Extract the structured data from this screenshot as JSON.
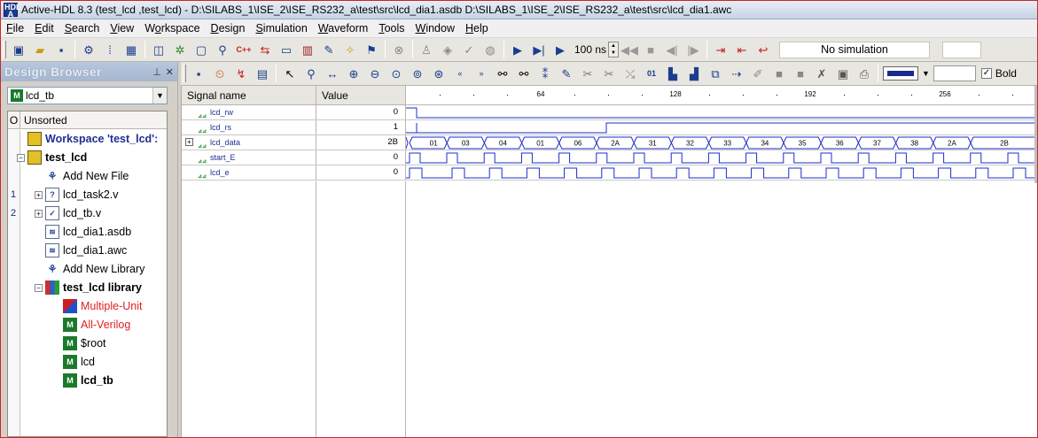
{
  "title": "Active-HDL 8.3 (test_lcd ,test_lcd) - D:\\SILABS_1\\ISE_2\\ISE_RS232_a\\test\\src\\lcd_dia1.asdb D:\\SILABS_1\\ISE_2\\ISE_RS232_a\\test\\src\\lcd_dia1.awc",
  "app_icon": {
    "top": "HDL",
    "bottom": "A"
  },
  "menu": [
    {
      "label": "File",
      "ul": "F"
    },
    {
      "label": "Edit",
      "ul": "E"
    },
    {
      "label": "Search",
      "ul": "S"
    },
    {
      "label": "View",
      "ul": "V"
    },
    {
      "label": "Workspace",
      "ul": "o"
    },
    {
      "label": "Design",
      "ul": "D"
    },
    {
      "label": "Simulation",
      "ul": "S"
    },
    {
      "label": "Waveform",
      "ul": "W"
    },
    {
      "label": "Tools",
      "ul": "T"
    },
    {
      "label": "Window",
      "ul": "W"
    },
    {
      "label": "Help",
      "ul": "H"
    }
  ],
  "toolbar": {
    "run_time": "100 ns",
    "sim_status": "No simulation"
  },
  "design_browser": {
    "title": "Design Browser",
    "selected_design": "lcd_tb",
    "header_o": "O",
    "header_sort": "Unsorted",
    "items": [
      {
        "num": "",
        "label": "Workspace 'test_lcd':",
        "style": "bold navy"
      },
      {
        "num": "",
        "label": "test_lcd",
        "style": "bold"
      },
      {
        "num": "",
        "label": "Add New File",
        "style": ""
      },
      {
        "num": "1",
        "label": "lcd_task2.v",
        "style": ""
      },
      {
        "num": "2",
        "label": "lcd_tb.v",
        "style": ""
      },
      {
        "num": "",
        "label": "lcd_dia1.asdb",
        "style": ""
      },
      {
        "num": "",
        "label": "lcd_dia1.awc",
        "style": ""
      },
      {
        "num": "",
        "label": "Add New Library",
        "style": ""
      },
      {
        "num": "",
        "label": "test_lcd library",
        "style": "bold"
      },
      {
        "num": "",
        "label": "Multiple-Unit",
        "style": "red"
      },
      {
        "num": "",
        "label": "All-Verilog",
        "style": "red"
      },
      {
        "num": "",
        "label": "$root",
        "style": ""
      },
      {
        "num": "",
        "label": "lcd",
        "style": ""
      },
      {
        "num": "",
        "label": "lcd_tb",
        "style": "bold"
      }
    ]
  },
  "waveform": {
    "col_signal": "Signal name",
    "col_value": "Value",
    "time_ticks": [
      "64",
      "128",
      "192",
      "256"
    ],
    "signals": [
      {
        "name": "lcd_rw",
        "value": "0"
      },
      {
        "name": "lcd_rs",
        "value": "1"
      },
      {
        "name": "lcd_data",
        "value": "2B",
        "expandable": true
      },
      {
        "name": "start_E",
        "value": "0"
      },
      {
        "name": "lcd_e",
        "value": "0"
      }
    ],
    "bus_values": [
      "01",
      "03",
      "04",
      "01",
      "06",
      "2A",
      "31",
      "32",
      "33",
      "34",
      "35",
      "36",
      "37",
      "38",
      "2A",
      "2B"
    ]
  },
  "colors": {
    "wave": "#1a2fc8",
    "accent": "#1f2f8f",
    "red_label": "#e02020"
  }
}
